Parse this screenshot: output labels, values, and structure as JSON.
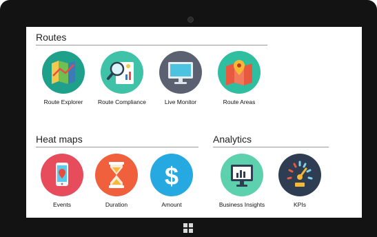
{
  "sections": {
    "routes": {
      "title": "Routes",
      "tiles": [
        {
          "label": "Route Explorer",
          "icon": "map-icon",
          "color": "#1ea08a"
        },
        {
          "label": "Route Compliance",
          "icon": "magnifier-report-icon",
          "color": "#3fc2a7"
        },
        {
          "label": "Live Monitor",
          "icon": "monitor-icon",
          "color": "#5b6170"
        },
        {
          "label": "Route Areas",
          "icon": "map-pin-icon",
          "color": "#2fbea0"
        }
      ]
    },
    "heatmaps": {
      "title": "Heat maps",
      "tiles": [
        {
          "label": "Events",
          "icon": "phone-location-icon",
          "color": "#e74c5c"
        },
        {
          "label": "Duration",
          "icon": "hourglass-icon",
          "color": "#f0603c"
        },
        {
          "label": "Amount",
          "icon": "dollar-icon",
          "color": "#25a9e0"
        }
      ]
    },
    "analytics": {
      "title": "Analytics",
      "tiles": [
        {
          "label": "Business Insights",
          "icon": "chart-monitor-icon",
          "color": "#5dd1ad"
        },
        {
          "label": "KPIs",
          "icon": "gauge-icon",
          "color": "#2f3d52"
        }
      ]
    }
  }
}
